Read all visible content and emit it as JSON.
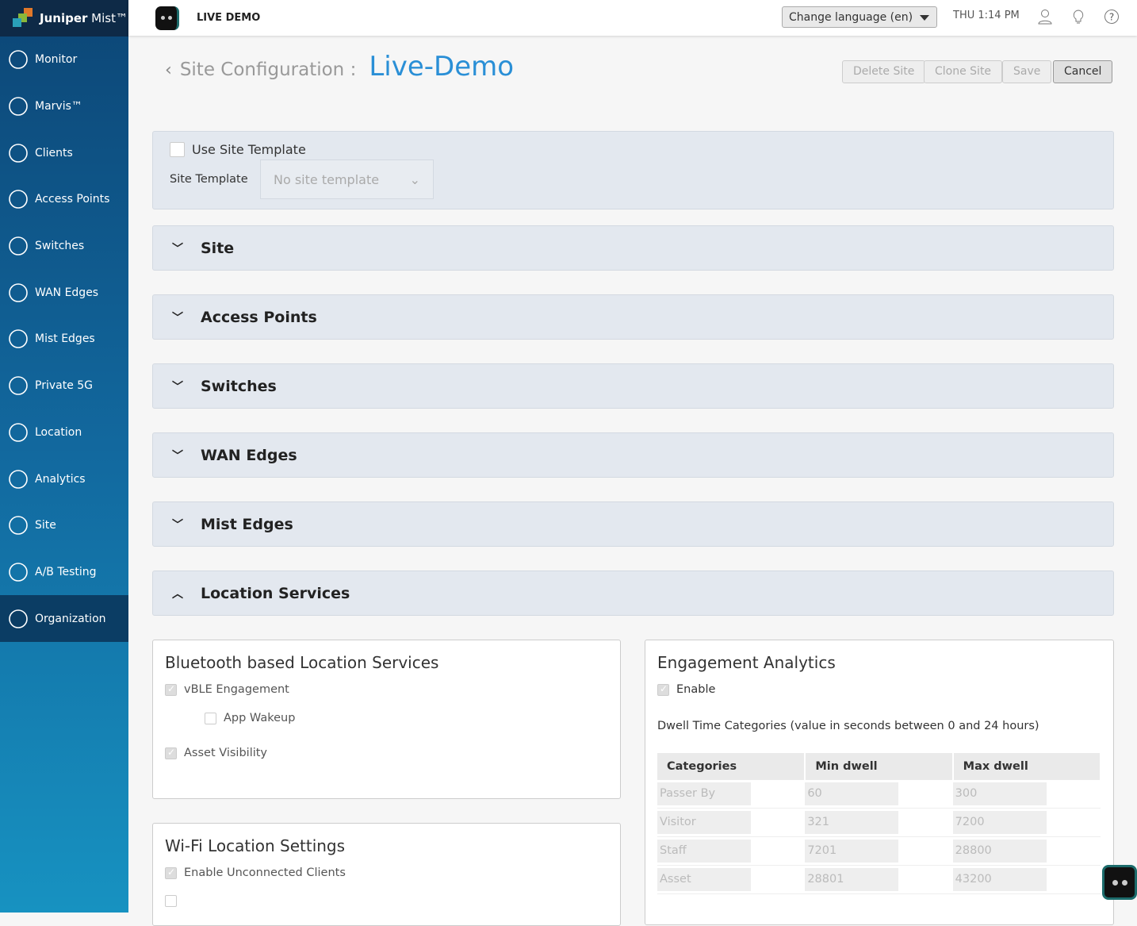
{
  "brand": {
    "name_bold": "Juniper",
    "name_light": "Mist™"
  },
  "sidebar": {
    "items": [
      {
        "label": "Monitor",
        "icon": "monitor-icon"
      },
      {
        "label": "Marvis™",
        "icon": "marvis-icon"
      },
      {
        "label": "Clients",
        "icon": "clients-icon"
      },
      {
        "label": "Access Points",
        "icon": "access-point-icon"
      },
      {
        "label": "Switches",
        "icon": "switch-icon"
      },
      {
        "label": "WAN Edges",
        "icon": "wan-edge-icon"
      },
      {
        "label": "Mist Edges",
        "icon": "mist-edge-icon"
      },
      {
        "label": "Private 5G",
        "icon": "antenna-icon"
      },
      {
        "label": "Location",
        "icon": "location-icon"
      },
      {
        "label": "Analytics",
        "icon": "analytics-icon"
      },
      {
        "label": "Site",
        "icon": "site-icon"
      },
      {
        "label": "A/B Testing",
        "icon": "ab-testing-icon"
      },
      {
        "label": "Organization",
        "icon": "globe-icon",
        "selected": true
      }
    ]
  },
  "header": {
    "org": "LIVE DEMO",
    "language": "Change language (en)",
    "time": "THU 1:14 PM"
  },
  "page": {
    "title": "Site Configuration :",
    "site": "Live-Demo",
    "buttons": {
      "delete": "Delete Site",
      "clone": "Clone Site",
      "save": "Save",
      "cancel": "Cancel"
    }
  },
  "template": {
    "use_label": "Use Site Template",
    "label": "Site Template",
    "placeholder": "No site template"
  },
  "sections": [
    "Site",
    "Access Points",
    "Switches",
    "WAN Edges",
    "Mist Edges",
    "Location Services"
  ],
  "bluetooth": {
    "title": "Bluetooth based Location Services",
    "vble": "vBLE Engagement",
    "wakeup": "App Wakeup",
    "asset": "Asset Visibility"
  },
  "wifi": {
    "title": "Wi-Fi Location Settings",
    "unconnected": "Enable Unconnected Clients"
  },
  "engagement": {
    "title": "Engagement Analytics",
    "enable": "Enable",
    "dwell_desc": "Dwell Time Categories (value in seconds between 0 and 24 hours)",
    "headers": [
      "Categories",
      "Min dwell",
      "Max dwell"
    ],
    "rows": [
      [
        "Passer By",
        "60",
        "300"
      ],
      [
        "Visitor",
        "321",
        "7200"
      ],
      [
        "Staff",
        "7201",
        "28800"
      ],
      [
        "Asset",
        "28801",
        "43200"
      ]
    ]
  }
}
